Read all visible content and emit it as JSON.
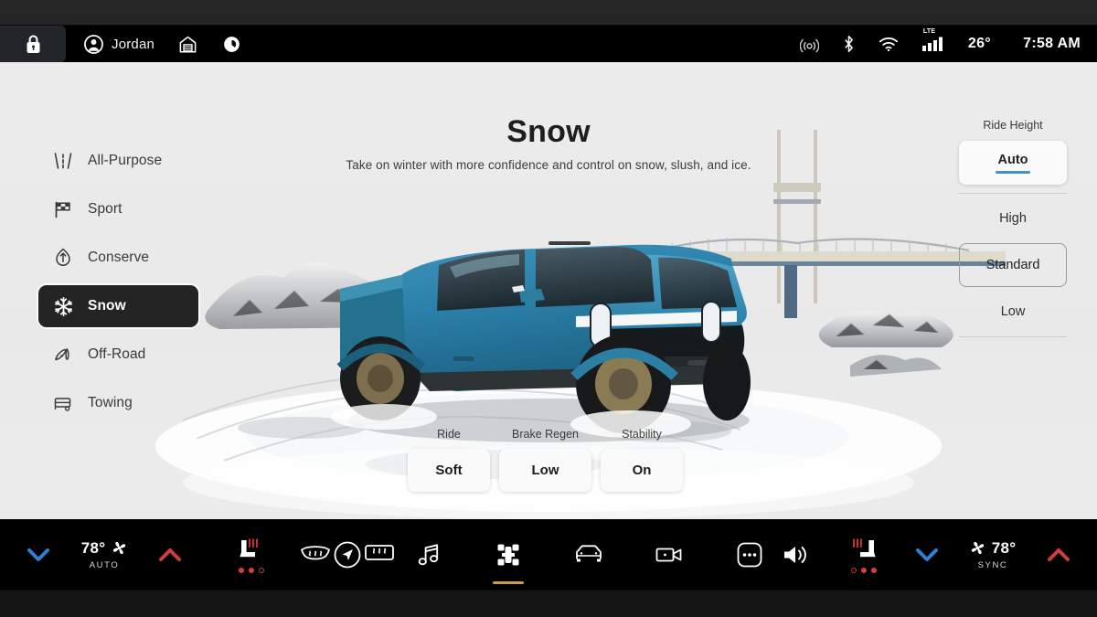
{
  "statusbar": {
    "lock_icon": "lock-icon",
    "profile_icon": "user-avatar-icon",
    "profile_name": "Jordan",
    "garage_icon": "garage-icon",
    "rivian_icon": "rivian-logo-icon",
    "connectivity_icon": "wireless-broadcast-icon",
    "bluetooth_icon": "bluetooth-icon",
    "wifi_icon": "wifi-icon",
    "cellular_icon": "cellular-signal-icon",
    "cellular_label": "LTE",
    "temperature": "26°",
    "clock": "7:58 AM"
  },
  "sidebar": {
    "items": [
      {
        "label": "All-Purpose",
        "icon": "road-icon",
        "active": false
      },
      {
        "label": "Sport",
        "icon": "checkered-flag-icon",
        "active": false
      },
      {
        "label": "Conserve",
        "icon": "leaf-icon",
        "active": false
      },
      {
        "label": "Snow",
        "icon": "snowflake-icon",
        "active": true
      },
      {
        "label": "Off-Road",
        "icon": "off-road-terrain-icon",
        "active": false
      },
      {
        "label": "Towing",
        "icon": "trailer-icon",
        "active": false
      }
    ]
  },
  "hero": {
    "title": "Snow",
    "subtitle": "Take on winter with more confidence and control on snow, slush, and ice.",
    "vehicle": "blue pickup truck on snowy road with suspension bridge"
  },
  "ride_height": {
    "title": "Ride Height",
    "selected": "Auto",
    "options": [
      {
        "label": "Auto",
        "state": "selected"
      },
      {
        "label": "High",
        "state": "plain"
      },
      {
        "label": "Standard",
        "state": "outlined"
      },
      {
        "label": "Low",
        "state": "plain"
      }
    ],
    "accent_color": "#3d8fd6"
  },
  "settings": [
    {
      "label": "Ride",
      "value": "Soft"
    },
    {
      "label": "Brake Regen",
      "value": "Low"
    },
    {
      "label": "Stability",
      "value": "On"
    }
  ],
  "taskbar": {
    "left_climate": {
      "down_icon": "chevron-down-icon",
      "temperature": "78°",
      "fan_icon": "fan-icon",
      "mode_label": "AUTO",
      "up_icon": "chevron-up-icon"
    },
    "left_buttons": [
      {
        "icon": "heated-seat-icon",
        "name": "driver-seat-heater",
        "dots": [
          true,
          true,
          false
        ]
      },
      {
        "icon": "front-defrost-icon",
        "name": "front-defrost"
      },
      {
        "icon": "rear-defrost-icon",
        "name": "rear-defrost"
      }
    ],
    "nav": [
      {
        "icon": "navigation-icon",
        "name": "navigation",
        "active": false
      },
      {
        "icon": "music-note-icon",
        "name": "media",
        "active": false
      },
      {
        "icon": "vehicle-chassis-icon",
        "name": "drive-modes",
        "active": true
      },
      {
        "icon": "car-front-icon",
        "name": "vehicle",
        "active": false
      },
      {
        "icon": "camera-icon",
        "name": "camera",
        "active": false
      },
      {
        "icon": "ellipsis-icon",
        "name": "more",
        "active": false
      }
    ],
    "right_buttons": [
      {
        "icon": "volume-icon",
        "name": "volume"
      },
      {
        "icon": "heated-seat-icon",
        "name": "passenger-seat-heater",
        "dots": [
          false,
          true,
          true
        ]
      }
    ],
    "right_climate": {
      "down_icon": "chevron-down-icon",
      "fan_icon": "fan-icon",
      "temperature": "78°",
      "mode_label": "SYNC",
      "up_icon": "chevron-up-icon"
    },
    "accent_color": "#c89a52",
    "up_arrow_color": "#cf3d3d",
    "down_arrow_color": "#2f7fd6"
  }
}
